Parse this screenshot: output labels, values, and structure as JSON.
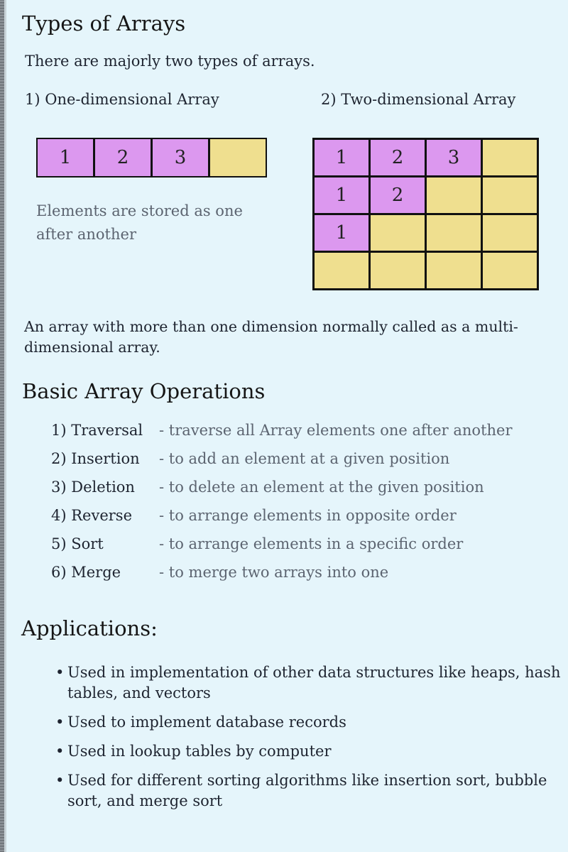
{
  "types": {
    "title": "Types of Arrays",
    "intro": "There are majorly two types of arrays.",
    "one_d": {
      "label": "1) One-dimensional Array",
      "cells": [
        "1",
        "2",
        "3",
        ""
      ],
      "note": "Elements are stored as one after another"
    },
    "two_d": {
      "label": "2) Two-dimensional Array",
      "rows": [
        [
          "1",
          "2",
          "3",
          ""
        ],
        [
          "1",
          "2",
          "",
          ""
        ],
        [
          "1",
          "",
          "",
          ""
        ],
        [
          "",
          "",
          "",
          ""
        ]
      ]
    },
    "multi_note": "An array with more than one dimension normally called as a multi-dimensional array."
  },
  "operations": {
    "title": "Basic Array Operations",
    "items": [
      {
        "name": "1) Traversal",
        "desc": "- traverse all Array elements one after another"
      },
      {
        "name": "2) Insertion",
        "desc": "- to add an element at a given position"
      },
      {
        "name": "3) Deletion",
        "desc": "- to delete an element at the given position"
      },
      {
        "name": "4) Reverse",
        "desc": "- to arrange elements in opposite order"
      },
      {
        "name": "5) Sort",
        "desc": "- to arrange elements in a specific order"
      },
      {
        "name": "6) Merge",
        "desc": "- to merge two arrays into one"
      }
    ]
  },
  "applications": {
    "title": "Applications:",
    "bullet": "•",
    "items": [
      "Used in implementation of other data structures like heaps, hash tables, and vectors",
      "Used to implement database records",
      "Used in lookup tables by computer",
      "Used for different sorting algorithms like insertion sort, bubble sort, and merge sort"
    ]
  },
  "colors": {
    "background": "#e5f5fb",
    "filled_cell": "#dc98ef",
    "empty_cell": "#efdf8f",
    "grid_border": "#111111"
  }
}
